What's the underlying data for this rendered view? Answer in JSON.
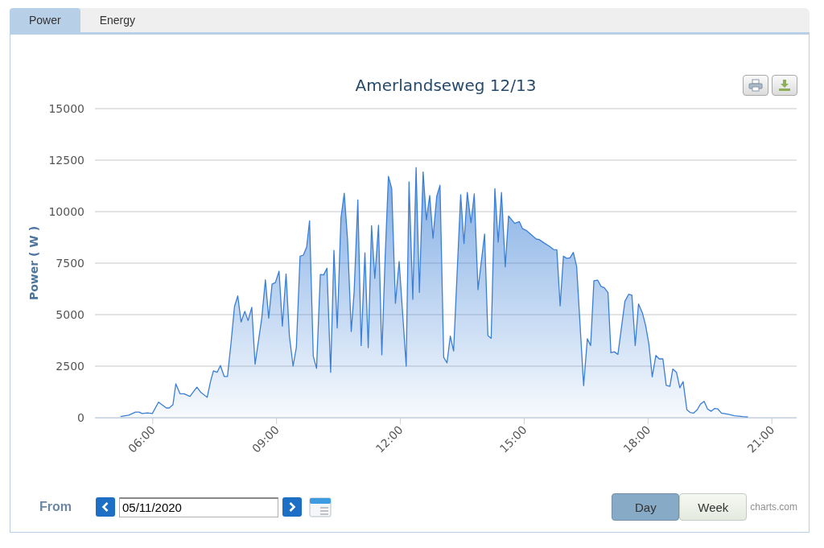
{
  "tabs": [
    {
      "label": "Power",
      "selected": true
    },
    {
      "label": "Energy",
      "selected": false
    }
  ],
  "chart": {
    "chart_data": {
      "type": "area",
      "title": "Amerlandseweg 12/13",
      "ylabel": "Power ( W )",
      "x": [
        5.22,
        5.42,
        5.58,
        5.67,
        5.74,
        5.87,
        5.99,
        6.14,
        6.33,
        6.4,
        6.49,
        6.56,
        6.66,
        6.76,
        6.9,
        7.07,
        7.17,
        7.32,
        7.4,
        7.47,
        7.56,
        7.64,
        7.73,
        7.81,
        7.9,
        7.98,
        8.06,
        8.14,
        8.23,
        8.31,
        8.4,
        8.48,
        8.64,
        8.73,
        8.81,
        8.89,
        8.97,
        9.06,
        9.14,
        9.23,
        9.31,
        9.4,
        9.48,
        9.57,
        9.65,
        9.73,
        9.8,
        9.89,
        9.97,
        10.06,
        10.14,
        10.22,
        10.31,
        10.39,
        10.47,
        10.56,
        10.64,
        10.72,
        10.81,
        10.88,
        10.97,
        11.05,
        11.14,
        11.22,
        11.3,
        11.38,
        11.47,
        11.55,
        11.63,
        11.71,
        11.79,
        11.88,
        11.97,
        12.14,
        12.21,
        12.3,
        12.38,
        12.46,
        12.55,
        12.63,
        12.71,
        12.79,
        12.88,
        12.96,
        13.05,
        13.13,
        13.21,
        13.29,
        13.46,
        13.54,
        13.62,
        13.71,
        13.79,
        13.88,
        14.04,
        14.12,
        14.2,
        14.29,
        14.37,
        14.45,
        14.54,
        14.62,
        14.77,
        14.88,
        14.96,
        15.05,
        15.29,
        15.36,
        15.48,
        15.61,
        15.71,
        15.79,
        15.87,
        15.95,
        16.03,
        16.11,
        16.19,
        16.27,
        16.44,
        16.53,
        16.61,
        16.69,
        16.78,
        16.86,
        16.94,
        17.03,
        17.1,
        17.18,
        17.27,
        17.44,
        17.53,
        17.61,
        17.69,
        17.77,
        17.86,
        17.94,
        18.02,
        18.1,
        18.19,
        18.27,
        18.36,
        18.44,
        18.53,
        18.6,
        18.69,
        18.77,
        18.85,
        18.94,
        19.02,
        19.1,
        19.19,
        19.27,
        19.36,
        19.44,
        19.53,
        19.61,
        19.69,
        19.78,
        19.95,
        20.09,
        20.29,
        20.42
      ],
      "series": [
        {
          "color": "#3a7fd5",
          "values": [
            50,
            120,
            270,
            270,
            200,
            230,
            200,
            750,
            470,
            470,
            620,
            1640,
            1160,
            1160,
            1030,
            1480,
            1220,
            990,
            1750,
            2270,
            2200,
            2530,
            2000,
            2000,
            3700,
            5390,
            5910,
            4640,
            5160,
            4710,
            5360,
            2590,
            4800,
            6690,
            4830,
            6480,
            6560,
            7110,
            4440,
            6980,
            3980,
            2500,
            3410,
            7840,
            7890,
            8280,
            9560,
            2980,
            2390,
            6950,
            6930,
            7250,
            2200,
            8120,
            4350,
            9690,
            10890,
            8650,
            4180,
            6110,
            10570,
            3500,
            8000,
            3400,
            9320,
            6760,
            9340,
            3050,
            7730,
            11710,
            11120,
            5550,
            7580,
            2500,
            11450,
            5740,
            12140,
            6080,
            11930,
            9600,
            10780,
            8710,
            10730,
            11280,
            2920,
            2660,
            3960,
            3240,
            10830,
            8450,
            10930,
            9460,
            10860,
            6210,
            8910,
            3980,
            3850,
            11120,
            8520,
            10930,
            7320,
            9790,
            9430,
            9520,
            9170,
            9090,
            8670,
            8650,
            8480,
            8320,
            8160,
            8150,
            5420,
            7840,
            7730,
            7760,
            8020,
            7340,
            1550,
            3830,
            3500,
            6650,
            6670,
            6370,
            6300,
            6070,
            3150,
            3200,
            3070,
            5650,
            5990,
            5940,
            3500,
            5520,
            5100,
            4480,
            3570,
            1980,
            3020,
            2850,
            2850,
            1570,
            1520,
            2360,
            2200,
            1450,
            1750,
            380,
            250,
            220,
            380,
            660,
            790,
            420,
            310,
            440,
            420,
            220,
            160,
            90,
            50,
            30
          ]
        }
      ],
      "xlim": [
        4.6,
        21.6
      ],
      "ylim": [
        0,
        15000
      ],
      "xticks": [
        {
          "value": 6,
          "label": "06:00"
        },
        {
          "value": 9,
          "label": "09:00"
        },
        {
          "value": 12,
          "label": "12:00"
        },
        {
          "value": 15,
          "label": "15:00"
        },
        {
          "value": 18,
          "label": "18:00"
        },
        {
          "value": 21,
          "label": "21:00"
        }
      ],
      "yticks": [
        0,
        2500,
        5000,
        7500,
        10000,
        12500,
        15000
      ],
      "grid": true
    }
  },
  "date_nav": {
    "label": "From",
    "date_value": "05/11/2020"
  },
  "range_buttons": [
    {
      "label": "Day",
      "selected": true
    },
    {
      "label": "Week",
      "selected": false
    }
  ],
  "credit": "charts.com"
}
